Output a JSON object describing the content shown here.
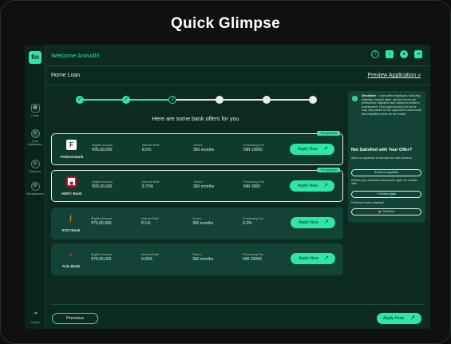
{
  "hero_title": "Quick Glimpse",
  "brand": {
    "logo_text": "fin"
  },
  "header": {
    "welcome": "Welcome Anirudh!"
  },
  "sidebar": {
    "items": [
      {
        "label": "Home",
        "icon": "grid-icon"
      },
      {
        "label": "Loan Application",
        "icon": "file-icon"
      },
      {
        "label": "Discover",
        "icon": "compass-icon"
      },
      {
        "label": "Management",
        "icon": "settings-icon"
      },
      {
        "label": "Logout",
        "icon": "logout-icon"
      }
    ]
  },
  "subheader": {
    "breadcrumb": "Home Loan",
    "preview_link": "Preview Application »"
  },
  "stepper": {
    "total": 6,
    "current": 3,
    "current_label": "3"
  },
  "offers": {
    "heading": "Here are some bank offers for you",
    "columns": {
      "eligible": "Eligible Amount",
      "rate": "Interest Rate",
      "tenure": "Tenure",
      "fee": "Processing Fee"
    },
    "apply_label": "Apply Now",
    "items": [
      {
        "bank": "Federal Bank",
        "tag": "Pre Approved",
        "eligible": "₹95,00,000",
        "rate": "8.5%",
        "tenure": "360 months",
        "fee": "INR 10000"
      },
      {
        "bank": "HDFC Bank",
        "tag": "Pre Approved",
        "eligible": "₹90,00,000",
        "rate": "8.75%",
        "tenure": "360 months",
        "fee": "INR 3000"
      },
      {
        "bank": "ICICI Bank",
        "tag": "",
        "eligible": "₹75,00,000",
        "rate": "8.1%",
        "tenure": "360 months",
        "fee": "0.2%"
      },
      {
        "bank": "Axis Bank",
        "tag": "",
        "eligible": "₹75,00,000",
        "rate": "9.05%",
        "tenure": "360 months",
        "fee": "INR 20000"
      }
    ]
  },
  "disclaimer": {
    "title": "Disclaimer",
    "text": " - Loan offers displayed, including eligibility, interest rates, and the terms are provisional, indicative and subject to lender's assessment. Final approval and the terms may vary based on the applicant's documents and eligibility review by the lender."
  },
  "not_satisfied": {
    "title": "Not Satisfied with Your Offer?",
    "co_applicant_text": "Add a co-applicant to increase the offer amount.",
    "co_applicant_btn": "Add Co-Applicant",
    "review_text": "Review your submitted documents again for a better offer",
    "review_btn": "Review Again",
    "lender_text": "Preferred lender missing?",
    "lender_btn": "Click here"
  },
  "footer": {
    "previous": "Previous",
    "apply": "Apply Now"
  },
  "colors": {
    "accent": "#2ee6a8",
    "panel": "#0c2a21",
    "card": "#124336"
  }
}
